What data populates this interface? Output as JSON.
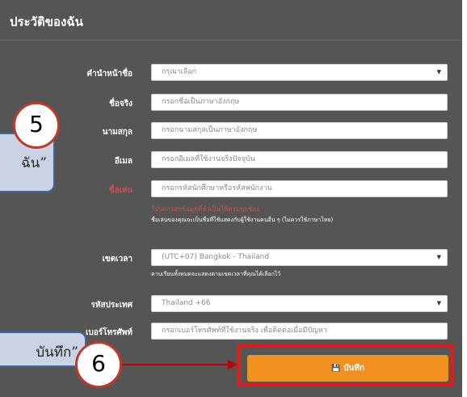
{
  "header": {
    "title": "ประวัติของฉัน"
  },
  "form": {
    "title_label": "คำนำหน้าชื่อ",
    "title_select_value": "กรุณาเลือก",
    "first_name_label": "ชื่อจริง",
    "first_name_placeholder": "กรอกชื่อเป็นภาษาอังกฤษ",
    "last_name_label": "นามสกุล",
    "last_name_placeholder": "กรอกนามสกุลเป็นภาษาอังกฤษ",
    "email_label": "อีเมล",
    "email_placeholder": "กรอกอีเมลที่ใช้งานจริงปัจจุบัน",
    "nickname_label": "ชื่อเล่น",
    "nickname_placeholder": "กรอกรหัสนักศึกษาหรือรหัสพนักงาน",
    "nickname_error": "โปรดกรอกข้อมูลที่จำเป็นให้ครบทุกช่อง",
    "nickname_hint": "ชื่อเล่นของคุณจะเป็นชื่อที่ใช้แสดงกับผู้ใช้งานคนอื่น ๆ (ไม่ควรใช้ภาษาไทย)",
    "timezone_label": "เขตเวลา",
    "timezone_value": "(UTC+07) Bangkok - Thailand",
    "timezone_hint": "คาบเรียนทั้งหมดจะแสดงตามเขตเวลาที่คุณได้เลือกไว้",
    "country_code_label": "รหัสประเทศ",
    "country_code_value": "Thailand +66",
    "phone_label": "เบอร์โทรศัพท์",
    "phone_placeholder": "กรอกเบอร์โทรศัพท์ที่ใช้งานจริง เพื่อติดต่อเมื่อมีปัญหา",
    "save_label": "บันทึก",
    "save_icon": "floppy-disk-icon"
  },
  "annotations": {
    "step5_number": "5",
    "step5_callout": "ฉัน”",
    "step6_number": "6",
    "step6_callout": "บันทึก”",
    "highlight_color": "#e21b1b"
  }
}
